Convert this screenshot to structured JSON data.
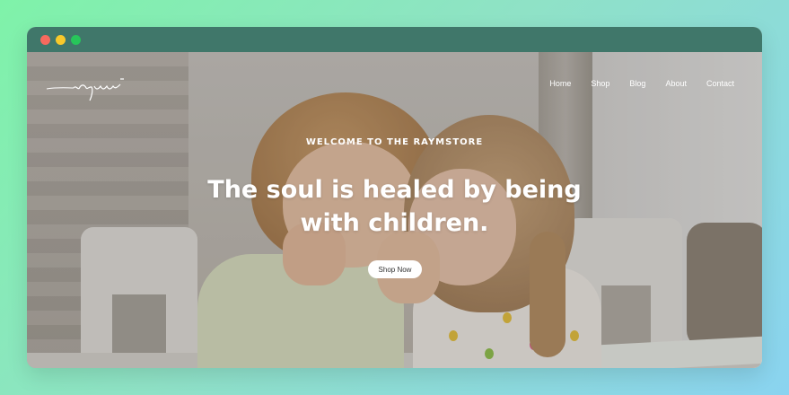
{
  "colors": {
    "titlebar": "#40776a",
    "dot_close": "#f76a5e",
    "dot_minimize": "#f8c92b",
    "dot_maximize": "#27c55a",
    "text": "#ffffff",
    "button_bg": "#ffffff",
    "button_text": "#333333"
  },
  "window": {
    "controls": [
      "close",
      "minimize",
      "maximize"
    ]
  },
  "brand": {
    "logo_text": "raym",
    "logo_icon": "signature-logo"
  },
  "nav": {
    "items": [
      {
        "label": "Home"
      },
      {
        "label": "Shop"
      },
      {
        "label": "Blog"
      },
      {
        "label": "About"
      },
      {
        "label": "Contact"
      }
    ]
  },
  "hero": {
    "eyebrow": "WELCOME TO THE RAYMSTORE",
    "headline_line1": "The soul is healed by being",
    "headline_line2": "with children.",
    "cta_label": "Shop Now",
    "image": "children-photo"
  }
}
